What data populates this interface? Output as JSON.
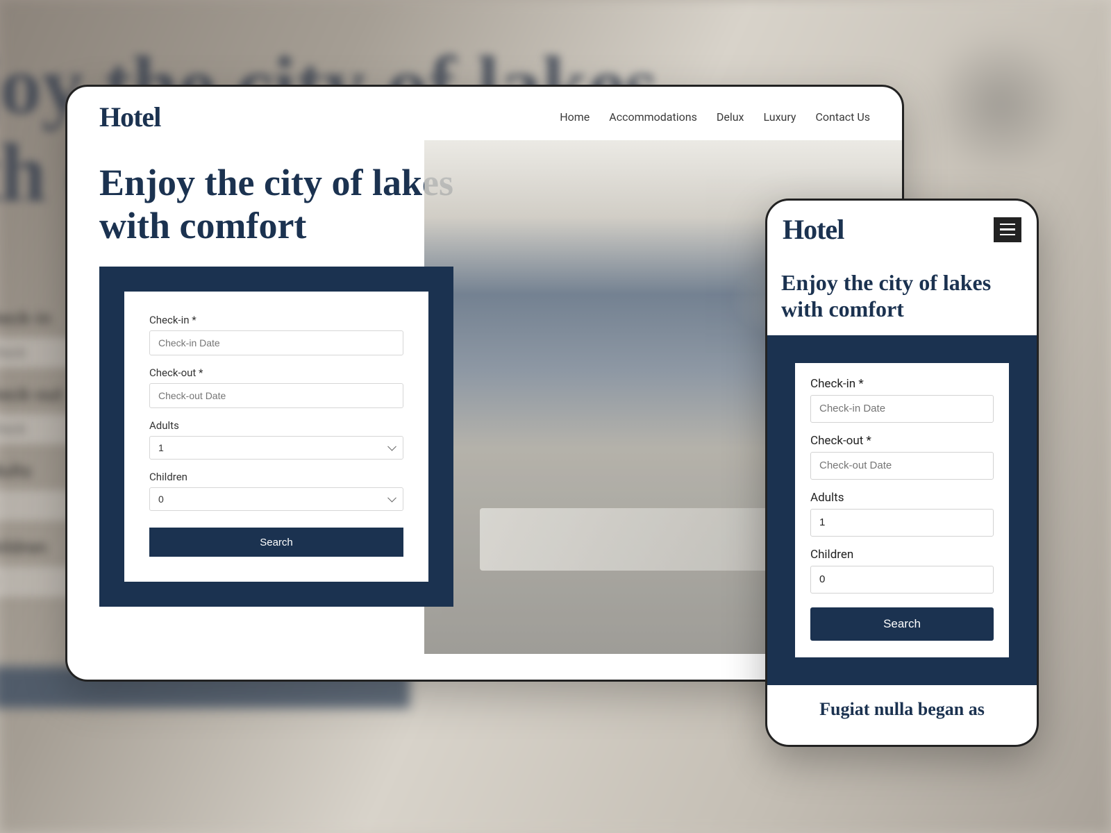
{
  "brand": "Hotel",
  "nav": {
    "items": [
      {
        "label": "Home"
      },
      {
        "label": "Accommodations"
      },
      {
        "label": "Delux"
      },
      {
        "label": "Luxury"
      },
      {
        "label": "Contact Us"
      }
    ]
  },
  "hero": {
    "title": "Enjoy the city of lakes\nwith comfort"
  },
  "search": {
    "checkin_label": "Check-in *",
    "checkin_placeholder": "Check-in Date",
    "checkout_label": "Check-out *",
    "checkout_placeholder": "Check-out Date",
    "adults_label": "Adults",
    "adults_value": "1",
    "children_label": "Children",
    "children_value": "0",
    "button_label": "Search"
  },
  "mobile": {
    "footer_text": "Fugiat nulla began as"
  },
  "bg": {
    "title": "joy the city of lakes\nth comfort",
    "checkin": "Check-in",
    "checkout": "Check-out",
    "adults": "Adults",
    "children": "Children"
  },
  "colors": {
    "primary": "#1b3250"
  }
}
